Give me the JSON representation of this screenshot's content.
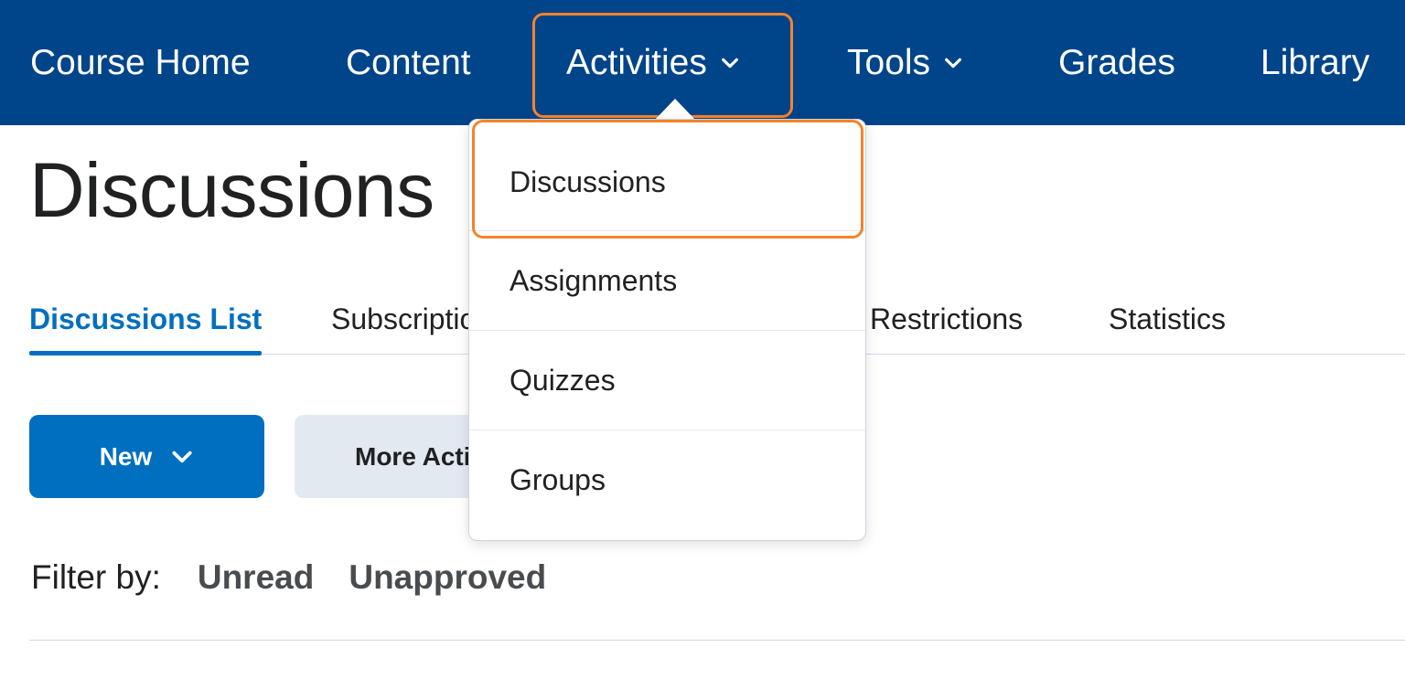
{
  "nav": {
    "items": [
      {
        "label": "Course Home",
        "has_dropdown": false
      },
      {
        "label": "Content",
        "has_dropdown": false
      },
      {
        "label": "Activities",
        "has_dropdown": true,
        "icon": "chevron-down-icon"
      },
      {
        "label": "Tools",
        "has_dropdown": true,
        "icon": "chevron-down-icon"
      },
      {
        "label": "Grades",
        "has_dropdown": false
      },
      {
        "label": "Library",
        "has_dropdown": false
      }
    ],
    "background": "#00448a",
    "highlighted_item": "Activities"
  },
  "activities_menu": {
    "items": [
      {
        "label": "Discussions"
      },
      {
        "label": "Assignments"
      },
      {
        "label": "Quizzes"
      },
      {
        "label": "Groups"
      }
    ],
    "highlighted_item": "Discussions"
  },
  "page": {
    "title": "Discussions"
  },
  "tabs": [
    {
      "label": "Discussions List",
      "active": true
    },
    {
      "label": "Subscriptions",
      "active": false
    },
    {
      "label": "Restrictions",
      "active": false
    },
    {
      "label": "Statistics",
      "active": false
    }
  ],
  "toolbar": {
    "new_label": "New",
    "new_icon": "chevron-down-icon",
    "more_actions_label": "More Actions"
  },
  "filter": {
    "label": "Filter by:",
    "options": [
      "Unread",
      "Unapproved"
    ]
  },
  "colors": {
    "accent": "#006fbf",
    "highlight_outline": "#f5832a",
    "secondary_button": "#e3e9f1"
  }
}
